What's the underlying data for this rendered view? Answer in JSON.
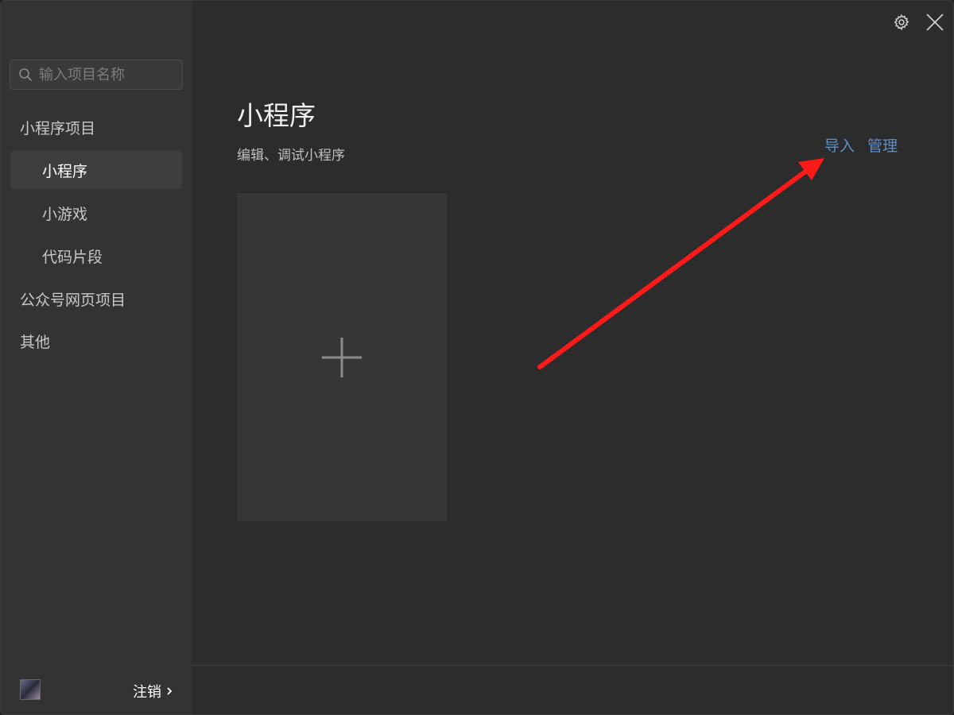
{
  "search": {
    "placeholder": "输入项目名称"
  },
  "sidebar": {
    "sections": [
      {
        "label": "小程序项目"
      },
      {
        "label": "公众号网页项目"
      },
      {
        "label": "其他"
      }
    ],
    "items": [
      {
        "label": "小程序",
        "active": true
      },
      {
        "label": "小游戏",
        "active": false
      },
      {
        "label": "代码片段",
        "active": false
      }
    ],
    "footer": {
      "logout_label": "注销"
    }
  },
  "main": {
    "title": "小程序",
    "subtitle": "编辑、调试小程序",
    "actions": {
      "import_label": "导入",
      "manage_label": "管理"
    }
  },
  "icons": {
    "search": "search-icon",
    "settings": "gear-icon",
    "close": "close-icon",
    "add": "plus-icon",
    "chevron": "chevron-right-icon"
  },
  "colors": {
    "accent_link": "#5b8fc7",
    "annotation_arrow": "#ff1a1a",
    "sidebar_bg": "#333333",
    "main_bg": "#2c2c2c"
  }
}
